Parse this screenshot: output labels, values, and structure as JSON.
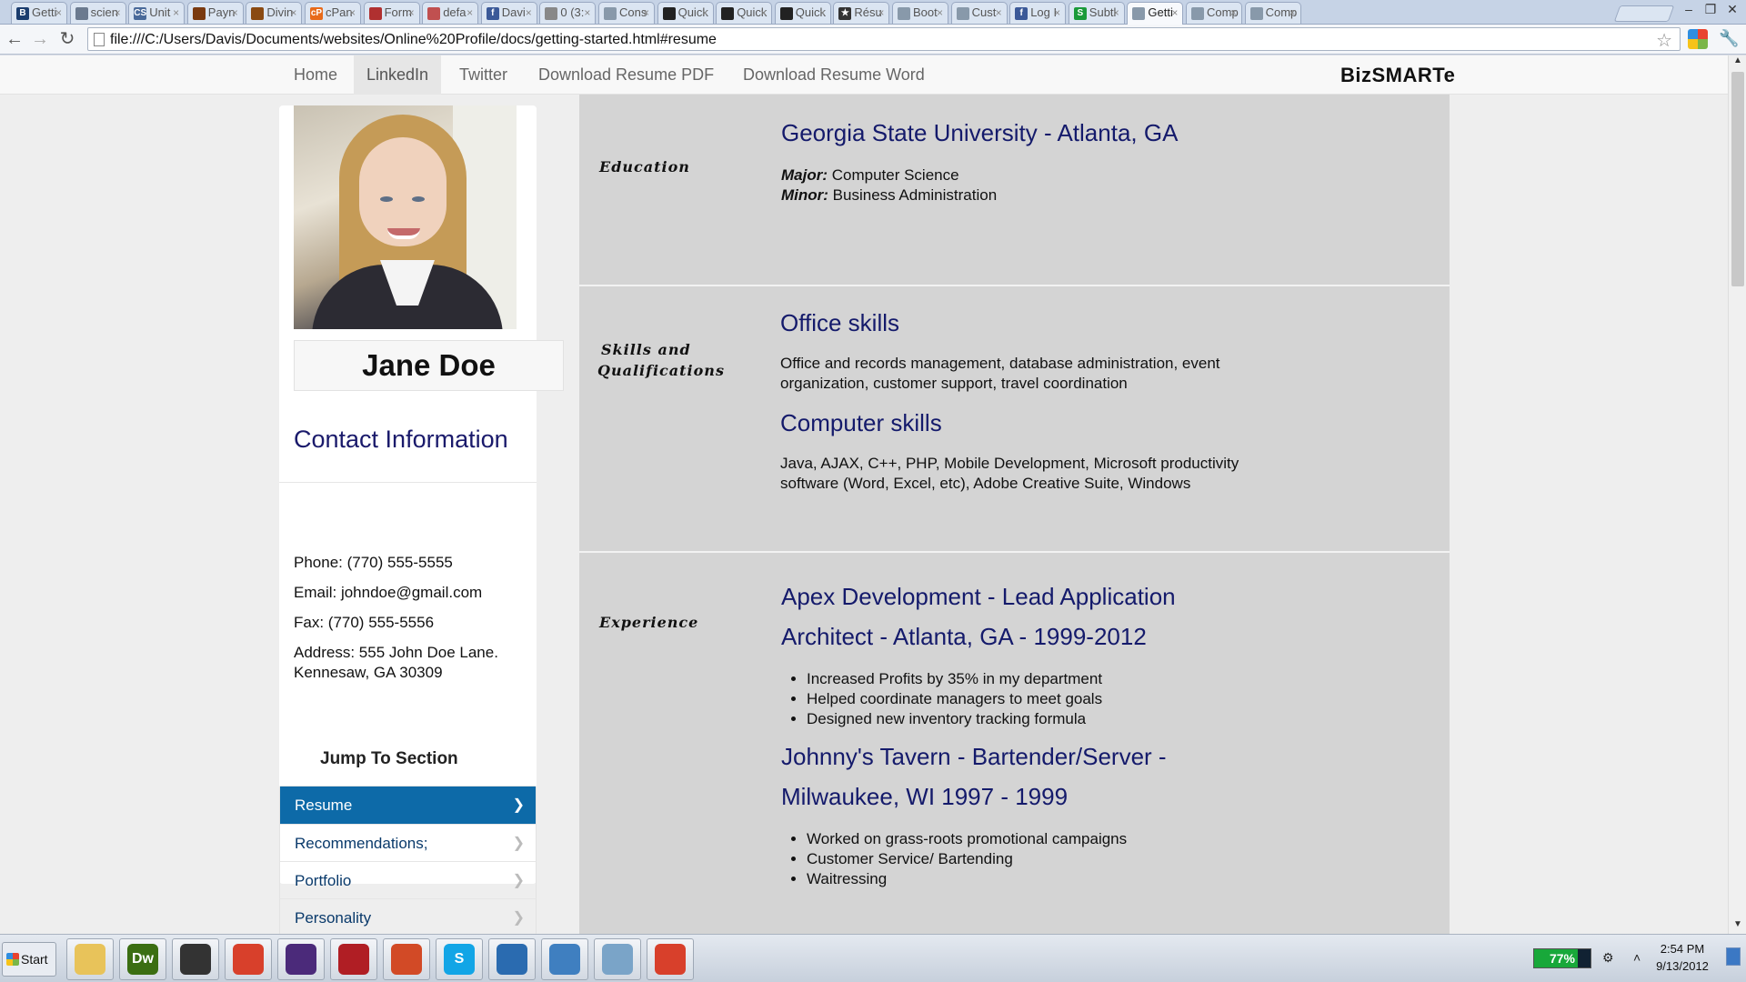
{
  "browser": {
    "tabs": [
      {
        "title": "Getti",
        "icon": "blogger-icon",
        "color": "#1b3d6e",
        "glyph": "B"
      },
      {
        "title": "scien",
        "icon": "document-icon",
        "color": "#6b7a8f",
        "glyph": ""
      },
      {
        "title": "Unit",
        "icon": "cs-icon",
        "color": "#4a6a9a",
        "glyph": "CS"
      },
      {
        "title": "Payn",
        "icon": "bookmark-icon",
        "color": "#7a3a10",
        "glyph": ""
      },
      {
        "title": "Divin",
        "icon": "bookmark-icon",
        "color": "#8a4a12",
        "glyph": ""
      },
      {
        "title": "cPan",
        "icon": "cpanel-icon",
        "color": "#e86a1a",
        "glyph": "cP"
      },
      {
        "title": "Form",
        "icon": "form-icon",
        "color": "#b03030",
        "glyph": ""
      },
      {
        "title": "defa",
        "icon": "file-icon",
        "color": "#c05050",
        "glyph": ""
      },
      {
        "title": "Davi",
        "icon": "facebook-icon",
        "color": "#3b5998",
        "glyph": "f"
      },
      {
        "title": "0 (3:",
        "icon": "page-icon",
        "color": "#888888",
        "glyph": ""
      },
      {
        "title": "Cons",
        "icon": "page-icon",
        "color": "#8899aa",
        "glyph": ""
      },
      {
        "title": "Quick",
        "icon": "github-icon",
        "color": "#222222",
        "glyph": ""
      },
      {
        "title": "Quick",
        "icon": "github-icon",
        "color": "#222222",
        "glyph": ""
      },
      {
        "title": "Quick",
        "icon": "github-icon",
        "color": "#222222",
        "glyph": ""
      },
      {
        "title": "Résu",
        "icon": "star-icon",
        "color": "#333333",
        "glyph": "★"
      },
      {
        "title": "Boot",
        "icon": "page-icon",
        "color": "#8899aa",
        "glyph": ""
      },
      {
        "title": "Cust",
        "icon": "page-icon",
        "color": "#8899aa",
        "glyph": ""
      },
      {
        "title": "Log I",
        "icon": "facebook-icon",
        "color": "#3b5998",
        "glyph": "f"
      },
      {
        "title": "Subtl",
        "icon": "s-icon",
        "color": "#1a9a3a",
        "glyph": "S"
      },
      {
        "title": "Getti",
        "icon": "page-icon",
        "color": "#8899aa",
        "glyph": "",
        "active": true
      },
      {
        "title": "Comp",
        "icon": "page-icon",
        "color": "#8899aa",
        "glyph": ""
      },
      {
        "title": "Comp",
        "icon": "page-icon",
        "color": "#8899aa",
        "glyph": ""
      }
    ],
    "url": "file:///C:/Users/Davis/Documents/websites/Online%20Profile/docs/getting-started.html#resume"
  },
  "nav": {
    "home": "Home",
    "linkedin": "LinkedIn",
    "twitter": "Twitter",
    "download_pdf": "Download Resume PDF",
    "download_word": "Download Resume Word",
    "brand": "BizSMARTe"
  },
  "sidebar": {
    "name": "Jane Doe",
    "contact_title": "Contact Information",
    "phone": "Phone:  (770) 555-5555",
    "email": "Email:  johndoe@gmail.com",
    "fax": "Fax: (770) 555-5556",
    "address_line1": "Address:  555 John Doe Lane.",
    "address_line2": "Kennesaw, GA 30309",
    "jump_title": "Jump To Section",
    "sections": [
      {
        "label": "Resume",
        "active": true
      },
      {
        "label": "Recommendations;",
        "active": false
      },
      {
        "label": "Portfolio",
        "active": false
      },
      {
        "label": "Personality",
        "active": false
      }
    ]
  },
  "resume": {
    "education": {
      "label": "Education",
      "school": "Georgia State University - Atlanta, GA",
      "major_label": "Major:",
      "major": "Computer Science",
      "minor_label": "Minor:",
      "minor": "Business Administration"
    },
    "skills": {
      "label_line1": "Skills and",
      "label_line2": "Qualifications",
      "office_title": "Office skills",
      "office_line1": "Office and records management, database administration, event",
      "office_line2": "organization, customer support, travel coordination",
      "computer_title": "Computer skills",
      "computer_line1": "Java, AJAX, C++, PHP, Mobile Development, Microsoft productivity",
      "computer_line2": "software (Word, Excel, etc), Adobe Creative Suite, Windows"
    },
    "experience": {
      "label": "Experience",
      "job1_line1": "Apex Development - Lead Application",
      "job1_line2": "Architect - Atlanta, GA - 1999-2012",
      "job1_bullets": [
        "Increased Profits by 35% in my department",
        "Helped coordinate managers to meet goals",
        "Designed new inventory tracking formula"
      ],
      "job2_line1": "Johnny's Tavern - Bartender/Server -",
      "job2_line2": "Milwaukee, WI 1997 - 1999",
      "job2_bullets": [
        "Worked on grass-roots promotional campaigns",
        "Customer Service/ Bartending",
        "Waitressing"
      ]
    }
  },
  "taskbar": {
    "start": "Start",
    "apps": [
      {
        "name": "explorer-icon",
        "color": "#e8c35a",
        "glyph": ""
      },
      {
        "name": "dreamweaver-icon",
        "color": "#3b6e12",
        "glyph": "Dw"
      },
      {
        "name": "github-icon",
        "color": "#333333",
        "glyph": ""
      },
      {
        "name": "chrome-icon",
        "color": "#d8402b",
        "glyph": ""
      },
      {
        "name": "eclipse-icon",
        "color": "#4b2a7a",
        "glyph": ""
      },
      {
        "name": "filezilla-icon",
        "color": "#b01e24",
        "glyph": ""
      },
      {
        "name": "presentation-icon",
        "color": "#d24a26",
        "glyph": ""
      },
      {
        "name": "skype-icon",
        "color": "#12a5e6",
        "glyph": "S"
      },
      {
        "name": "virtualbox-icon",
        "color": "#2a6bb0",
        "glyph": ""
      },
      {
        "name": "remote-desktop-icon",
        "color": "#3f7fc0",
        "glyph": ""
      },
      {
        "name": "notes-icon",
        "color": "#7aa4c8",
        "glyph": ""
      },
      {
        "name": "chrome-icon",
        "color": "#d8402b",
        "glyph": ""
      }
    ],
    "battery": "77%",
    "battery_level": 0.77,
    "time": "2:54 PM",
    "date": "9/13/2012"
  }
}
